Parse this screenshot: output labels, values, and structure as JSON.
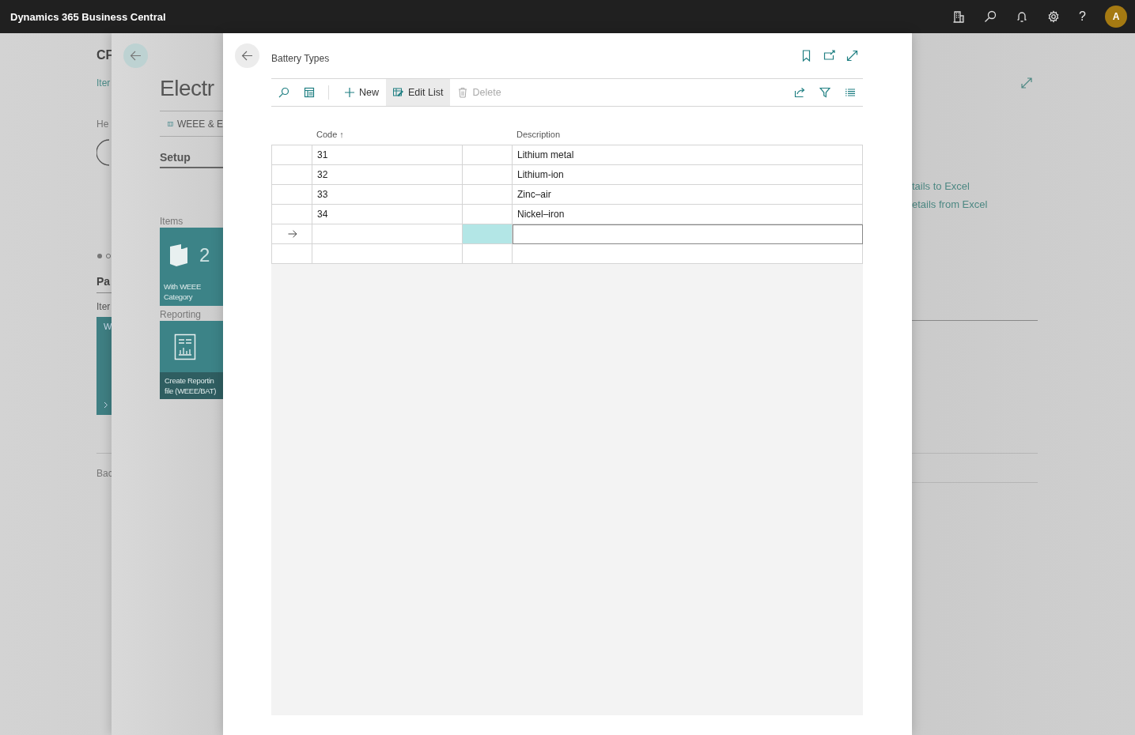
{
  "top_bar": {
    "title": "Dynamics 365 Business Central",
    "help": "?",
    "avatar": "A"
  },
  "background_page": {
    "title": "CF",
    "link": "Iter",
    "label": "He",
    "section": "Pa",
    "subsection": "Iter",
    "tile": "W",
    "footer_link": "Bac",
    "actions": [
      "tails to Excel",
      "etails from Excel"
    ]
  },
  "middle_page": {
    "title": "Electr",
    "tab": "WEEE & E",
    "section": "Setup",
    "groups": [
      {
        "title": "Items",
        "tile": {
          "kind": "count",
          "value": "2",
          "lines": [
            "With WEEE",
            "Category"
          ]
        }
      },
      {
        "title": "Reporting",
        "tile": {
          "kind": "report",
          "lines": [
            "Create Reportin",
            "file (WEEE/BAT)"
          ]
        }
      }
    ]
  },
  "dialog": {
    "title": "Battery Types",
    "actions": [
      {
        "kind": "new",
        "label": "New",
        "selected": false,
        "disabled": false
      },
      {
        "kind": "edit",
        "label": "Edit List",
        "selected": true,
        "disabled": false
      },
      {
        "kind": "delete",
        "label": "Delete",
        "selected": false,
        "disabled": true
      }
    ],
    "table": {
      "columns": [
        {
          "label": "Code",
          "sort": "↑"
        },
        {
          "label": "Description"
        }
      ],
      "rows": [
        {
          "code": "31",
          "description": "Lithium metal"
        },
        {
          "code": "32",
          "description": "Lithium-ion"
        },
        {
          "code": "33",
          "description": "Zinc–air"
        },
        {
          "code": "34",
          "description": "Nickel–iron"
        }
      ],
      "new_rows": [
        {
          "current": true
        },
        {
          "current": false
        }
      ]
    }
  }
}
